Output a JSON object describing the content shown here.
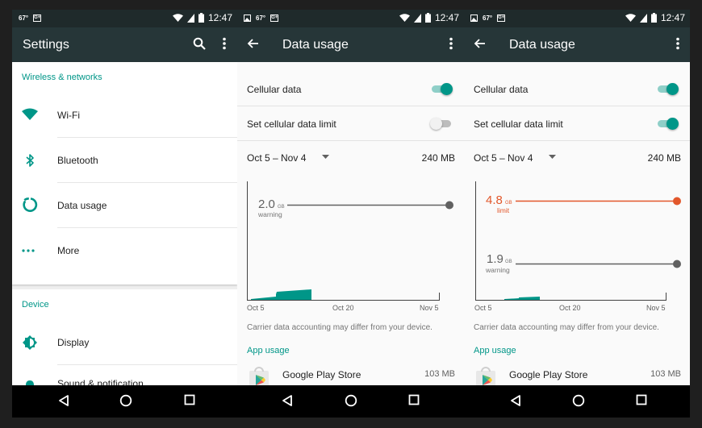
{
  "status": {
    "left_temp": "67°",
    "left_badge": "G+",
    "time": "12:47"
  },
  "settings": {
    "title": "Settings",
    "section_wireless": "Wireless & networks",
    "items": [
      {
        "label": "Wi-Fi",
        "icon": "wifi-icon"
      },
      {
        "label": "Bluetooth",
        "icon": "bluetooth-icon"
      },
      {
        "label": "Data usage",
        "icon": "data-usage-icon"
      },
      {
        "label": "More",
        "icon": "more-icon"
      }
    ],
    "section_device": "Device",
    "device_items": [
      {
        "label": "Display",
        "icon": "display-icon"
      },
      {
        "label": "Sound & notification",
        "icon": "bell-icon"
      }
    ]
  },
  "data_usage_a": {
    "title": "Data usage",
    "cellular_label": "Cellular data",
    "cellular_on": true,
    "limit_label": "Set cellular data limit",
    "limit_on": false,
    "cycle": "Oct 5 – Nov 4",
    "total": "240 MB",
    "warning_value": "2.0",
    "warning_unit": "GB",
    "warning_label": "warning",
    "x_ticks": [
      "Oct 5",
      "Oct 20",
      "Nov 5"
    ],
    "note": "Carrier data accounting may differ from your device.",
    "app_usage": "App usage",
    "app_name": "Google Play Store",
    "app_size": "103 MB"
  },
  "data_usage_b": {
    "title": "Data usage",
    "cellular_label": "Cellular data",
    "cellular_on": true,
    "limit_label": "Set cellular data limit",
    "limit_on": true,
    "cycle": "Oct 5 – Nov 4",
    "total": "240 MB",
    "limit_value": "4.8",
    "limit_unit": "GB",
    "limit_text": "limit",
    "warning_value": "1.9",
    "warning_unit": "GB",
    "warning_label": "warning",
    "x_ticks": [
      "Oct 5",
      "Oct 20",
      "Nov 5"
    ],
    "note": "Carrier data accounting may differ from your device.",
    "app_usage": "App usage",
    "app_name": "Google Play Store",
    "app_size": "103 MB"
  },
  "colors": {
    "accent": "#009688",
    "limit": "#e2572b",
    "appbar": "#263638",
    "statusbar": "#1f2a2b"
  }
}
